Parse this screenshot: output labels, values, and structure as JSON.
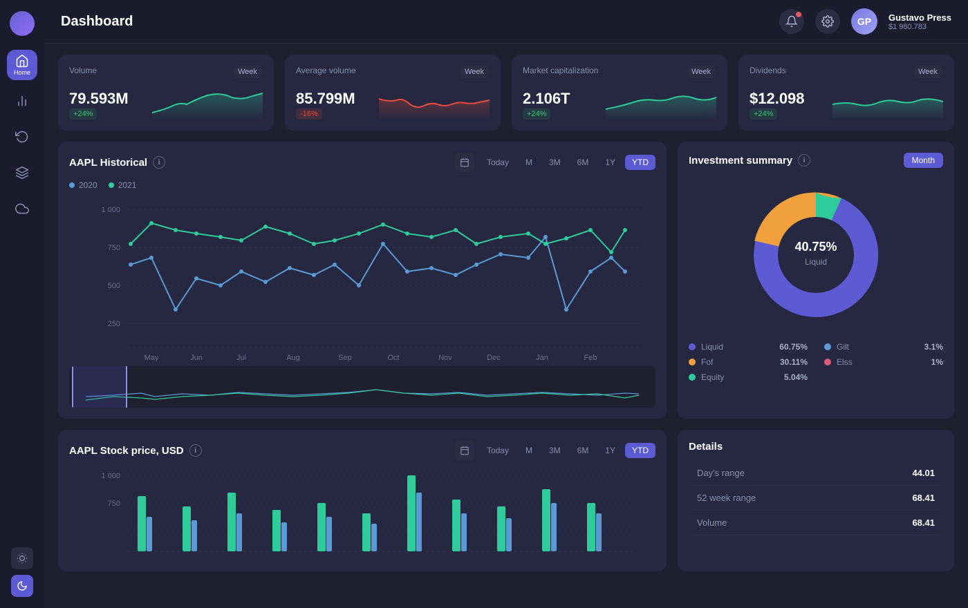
{
  "header": {
    "title": "Dashboard",
    "user": {
      "name": "Gustavo Press",
      "balance": "$1 980.783",
      "initials": "GP"
    }
  },
  "sidebar": {
    "items": [
      {
        "id": "home",
        "label": "Home",
        "active": true
      },
      {
        "id": "chart",
        "label": "Chart"
      },
      {
        "id": "sync",
        "label": "Sync"
      },
      {
        "id": "layers",
        "label": "Layers"
      },
      {
        "id": "cloud",
        "label": "Cloud"
      }
    ]
  },
  "stat_cards": [
    {
      "title": "Volume",
      "badge": "Week",
      "value": "79.593M",
      "change": "+24%",
      "change_type": "positive"
    },
    {
      "title": "Average volume",
      "badge": "Week",
      "value": "85.799M",
      "change": "-16%",
      "change_type": "negative"
    },
    {
      "title": "Market capitalization",
      "badge": "Week",
      "value": "2.106T",
      "change": "+24%",
      "change_type": "positive"
    },
    {
      "title": "Dividends",
      "badge": "Week",
      "value": "$12.098",
      "change": "+24%",
      "change_type": "positive"
    }
  ],
  "historical_chart": {
    "title": "AAPL Historical",
    "filters": [
      "Today",
      "M",
      "3M",
      "6M",
      "1Y",
      "YTD"
    ],
    "active_filter": "YTD",
    "legend": [
      {
        "label": "2020",
        "color": "#5b9bd5"
      },
      {
        "label": "2021",
        "color": "#2ecc9a"
      }
    ],
    "y_labels": [
      "1 000",
      "750",
      "500",
      "250"
    ],
    "x_labels": [
      "May",
      "Jun",
      "Jul",
      "Aug",
      "Sep",
      "Oct",
      "Nov",
      "Dec",
      "Jan",
      "Feb"
    ]
  },
  "investment_summary": {
    "title": "Investment summary",
    "filter": "Month",
    "center_value": "40.75%",
    "center_label": "Liquid",
    "segments": [
      {
        "label": "Liquid",
        "value": "60.75%",
        "color": "#5c5bd4"
      },
      {
        "label": "Gilt",
        "value": "3.1%",
        "color": "#5b9bd5"
      },
      {
        "label": "Fof",
        "value": "30.11%",
        "color": "#f0a03c"
      },
      {
        "label": "Elss",
        "value": "1%",
        "color": "#e05c7a"
      },
      {
        "label": "Equity",
        "value": "5.04%",
        "color": "#2ecc9a"
      }
    ]
  },
  "stock_price_chart": {
    "title": "AAPL Stock price, USD",
    "filters": [
      "Today",
      "M",
      "3M",
      "6M",
      "1Y",
      "YTD"
    ],
    "active_filter": "YTD",
    "y_labels": [
      "1 000",
      "750"
    ]
  },
  "details": {
    "title": "Details",
    "rows": [
      {
        "label": "Day's range",
        "value": "44.01"
      },
      {
        "label": "52 week range",
        "value": "68.41"
      },
      {
        "label": "Volume",
        "value": "68.41"
      }
    ]
  }
}
